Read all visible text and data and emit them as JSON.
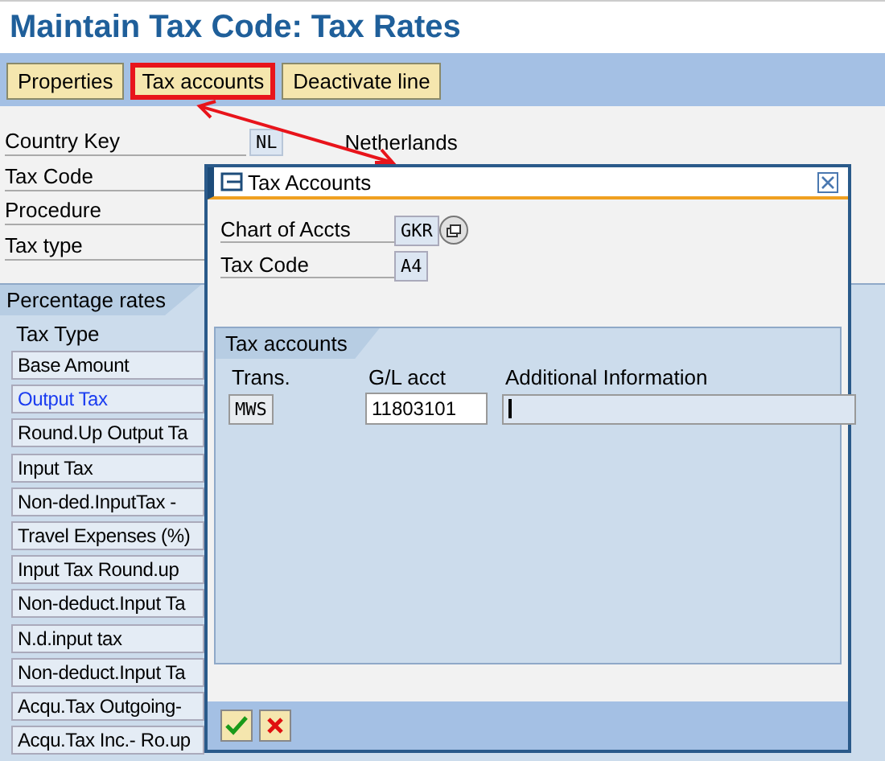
{
  "title": "Maintain Tax Code: Tax Rates",
  "toolbar": [
    {
      "label": "Properties",
      "highlighted": false
    },
    {
      "label": "Tax accounts",
      "highlighted": true
    },
    {
      "label": "Deactivate line",
      "highlighted": false
    }
  ],
  "header_fields": [
    {
      "label": "Country Key",
      "value": "NL",
      "description": "Netherlands"
    },
    {
      "label": "Tax Code"
    },
    {
      "label": "Procedure"
    },
    {
      "label": "Tax type"
    }
  ],
  "percentage_rates": {
    "title": "Percentage rates",
    "column": "Tax  Type",
    "rows": [
      {
        "label": "Base Amount",
        "selected": false
      },
      {
        "label": "Output Tax",
        "selected": true
      },
      {
        "label": "Round.Up Output Ta",
        "selected": false
      },
      {
        "label": "Input Tax",
        "selected": false
      },
      {
        "label": "Non-ded.InputTax -",
        "selected": false
      },
      {
        "label": "Travel Expenses (%)",
        "selected": false
      },
      {
        "label": "Input Tax Round.up",
        "selected": false
      },
      {
        "label": "Non-deduct.Input Ta",
        "selected": false
      },
      {
        "label": "N.d.input tax",
        "selected": false
      },
      {
        "label": "Non-deduct.Input Ta",
        "selected": false
      },
      {
        "label": "Acqu.Tax Outgoing-",
        "selected": false
      },
      {
        "label": "Acqu.Tax Inc.- Ro.up",
        "selected": false
      }
    ]
  },
  "dialog": {
    "title": "Tax Accounts",
    "fields": [
      {
        "label": "Chart of Accts",
        "value": "GKR",
        "match_button": true
      },
      {
        "label": "Tax Code",
        "value": "A4",
        "match_button": false
      }
    ],
    "group": {
      "title": "Tax accounts",
      "columns": [
        "Trans.",
        "G/L acct",
        "Additional Information"
      ],
      "row": {
        "trans": "MWS",
        "gl_acct": "11803101"
      }
    }
  }
}
